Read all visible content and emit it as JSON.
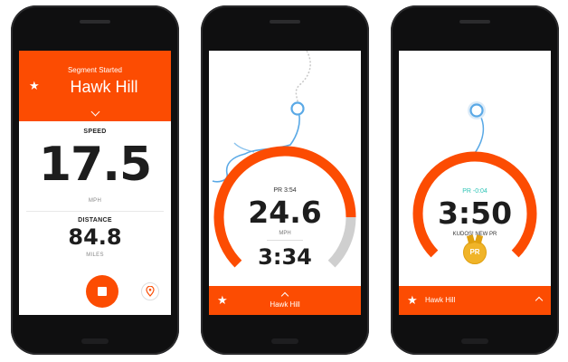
{
  "colors": {
    "accent": "#fc4c02",
    "route": "#5aa9e6",
    "pr": "#2ec4b6",
    "medal": "#f0b429"
  },
  "phone1": {
    "status": "Segment Started",
    "segment_name": "Hawk Hill",
    "star_icon": "star-icon",
    "speed": {
      "label": "SPEED",
      "value": "17.5",
      "unit": "MPH"
    },
    "distance": {
      "label": "DISTANCE",
      "value": "84.8",
      "unit": "MILES"
    }
  },
  "phone2": {
    "pr_time": "PR 3:54",
    "speed_value": "24.6",
    "speed_unit": "MPH",
    "elapsed_time": "3:34",
    "segment_name": "Hawk Hill"
  },
  "phone3": {
    "pr_delta": "PR -0:04",
    "time": "3:50",
    "message": "KUDOS! NEW PR",
    "badge": "PR",
    "segment_name": "Hawk Hill"
  }
}
